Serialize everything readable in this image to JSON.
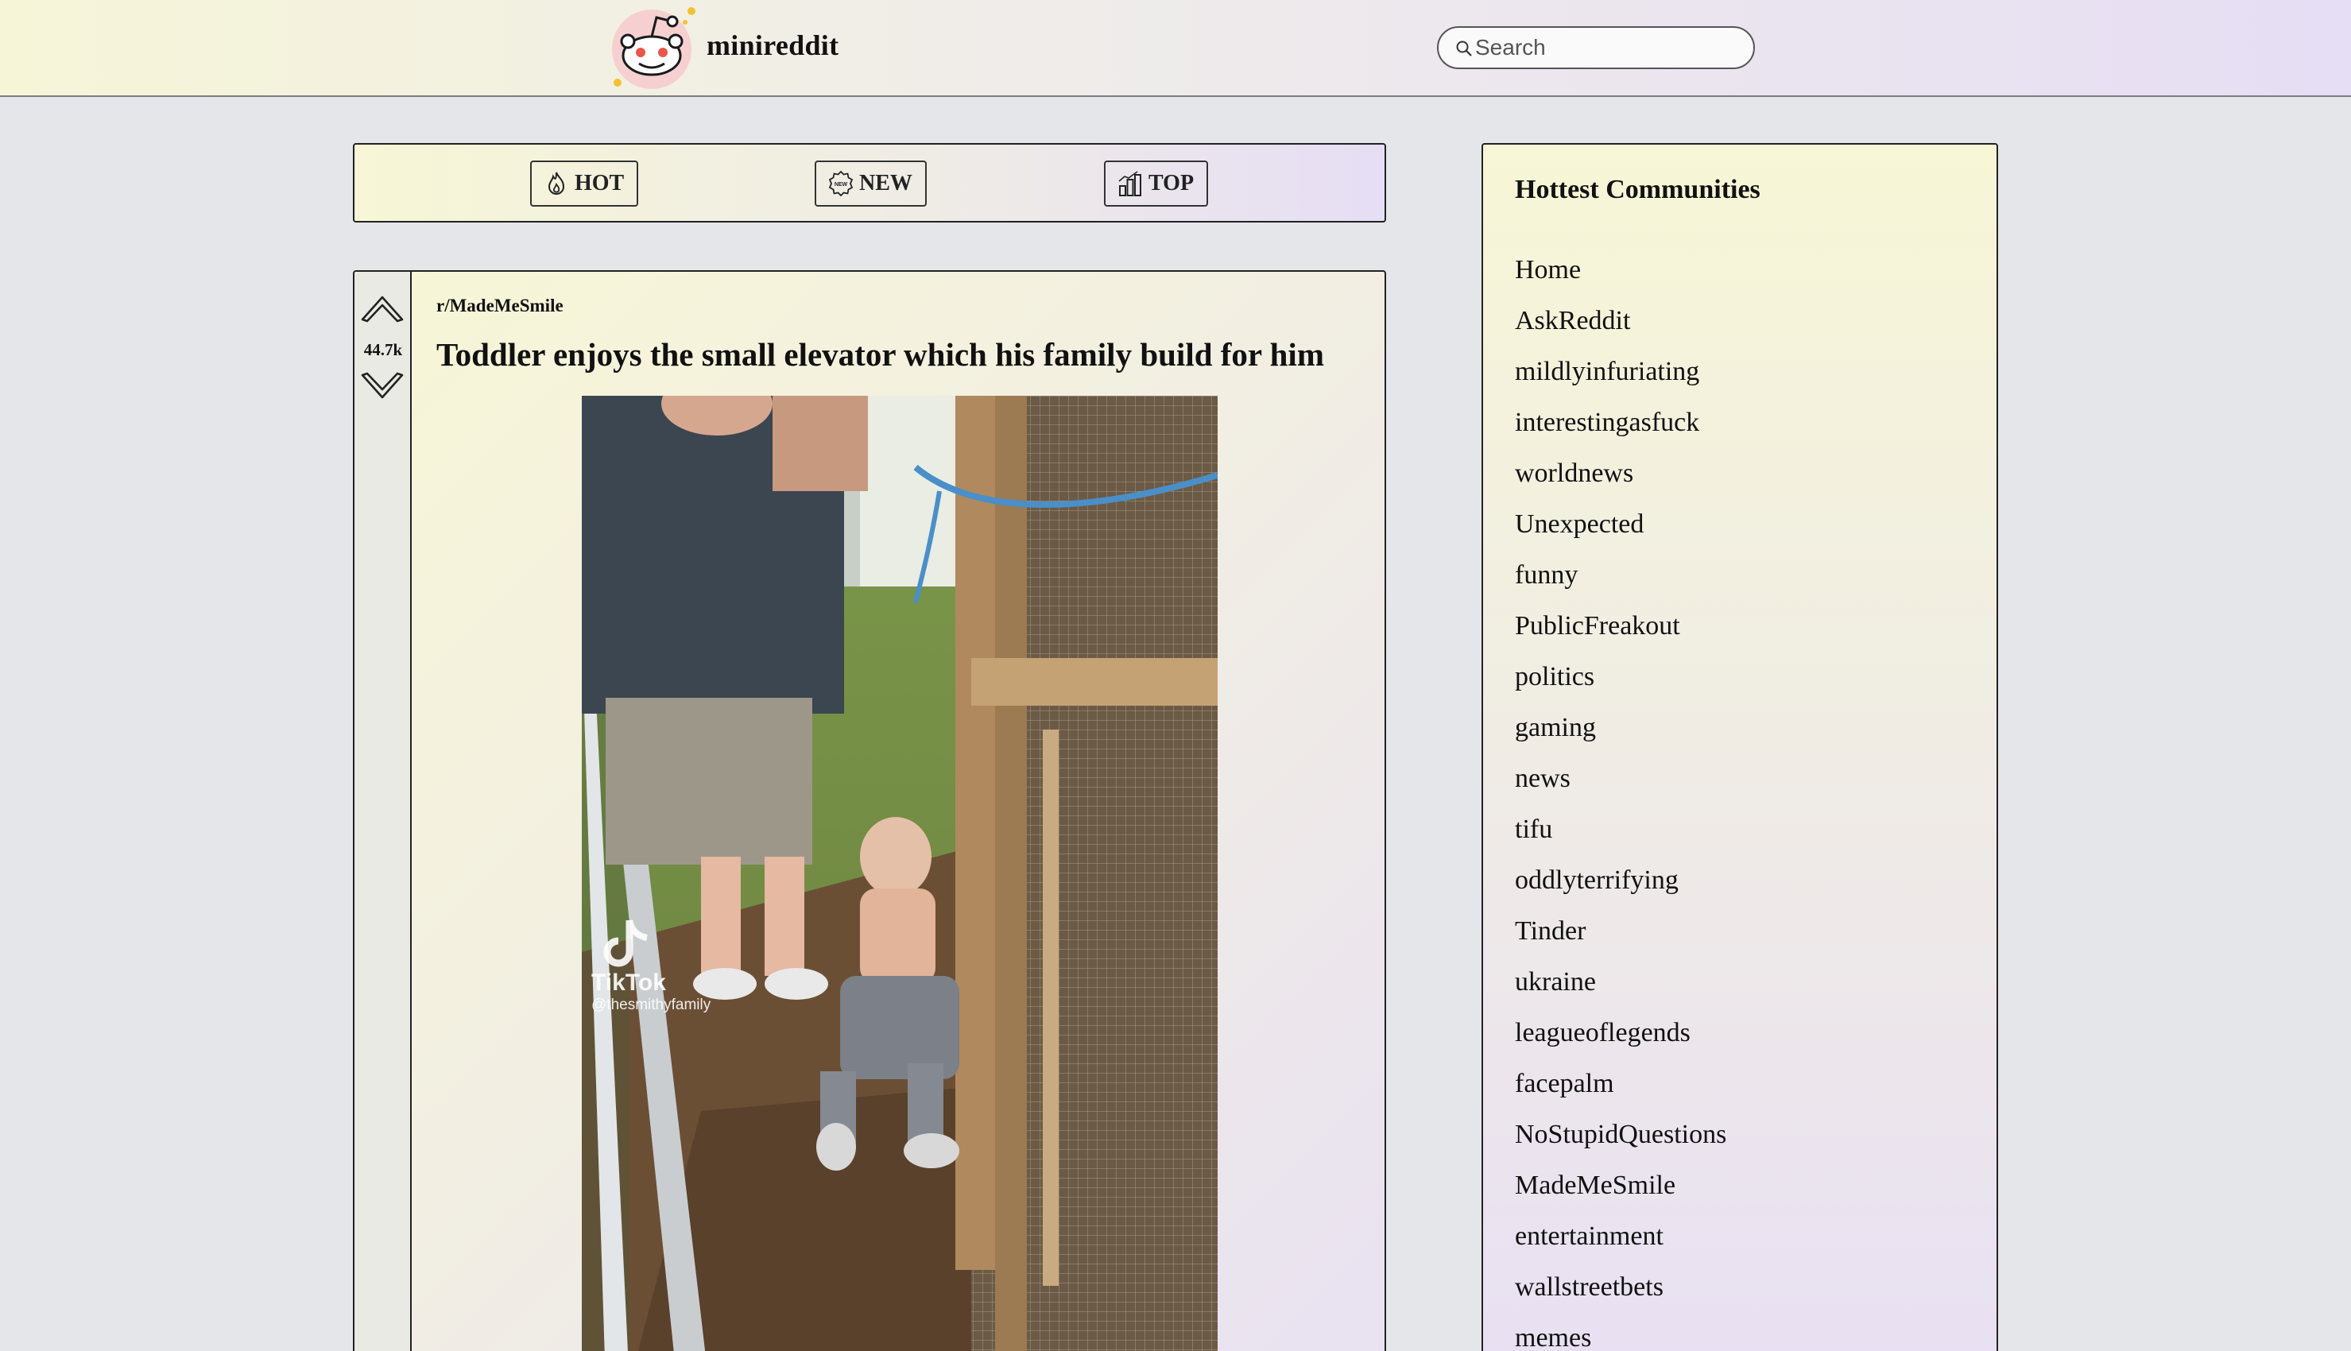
{
  "app": {
    "brand": "minireddit",
    "logo_icon": "reddit-alien-icon"
  },
  "search": {
    "placeholder": "Search",
    "icon": "search-icon"
  },
  "sort": {
    "buttons": [
      {
        "label": "HOT",
        "icon": "flame-icon"
      },
      {
        "label": "NEW",
        "icon": "new-badge-icon"
      },
      {
        "label": "TOP",
        "icon": "bar-chart-icon"
      }
    ]
  },
  "post": {
    "subreddit": "r/MadeMeSmile",
    "title": "Toddler enjoys the small elevator which his family build for him",
    "votes": "44.7k",
    "media_watermark": {
      "brand": "TikTok",
      "handle": "@thesmithyfamily"
    }
  },
  "sidebar": {
    "title": "Hottest Communities",
    "communities": [
      "Home",
      "AskReddit",
      "mildlyinfuriating",
      "interestingasfuck",
      "worldnews",
      "Unexpected",
      "funny",
      "PublicFreakout",
      "politics",
      "gaming",
      "news",
      "tifu",
      "oddlyterrifying",
      "Tinder",
      "ukraine",
      "leagueoflegends",
      "facepalm",
      "NoStupidQuestions",
      "MadeMeSmile",
      "entertainment",
      "wallstreetbets",
      "memes"
    ]
  },
  "colors": {
    "header_left": "#f6f5d8",
    "header_right": "#e6def4",
    "page_background": "#e5e6ea",
    "border": "#222222"
  }
}
